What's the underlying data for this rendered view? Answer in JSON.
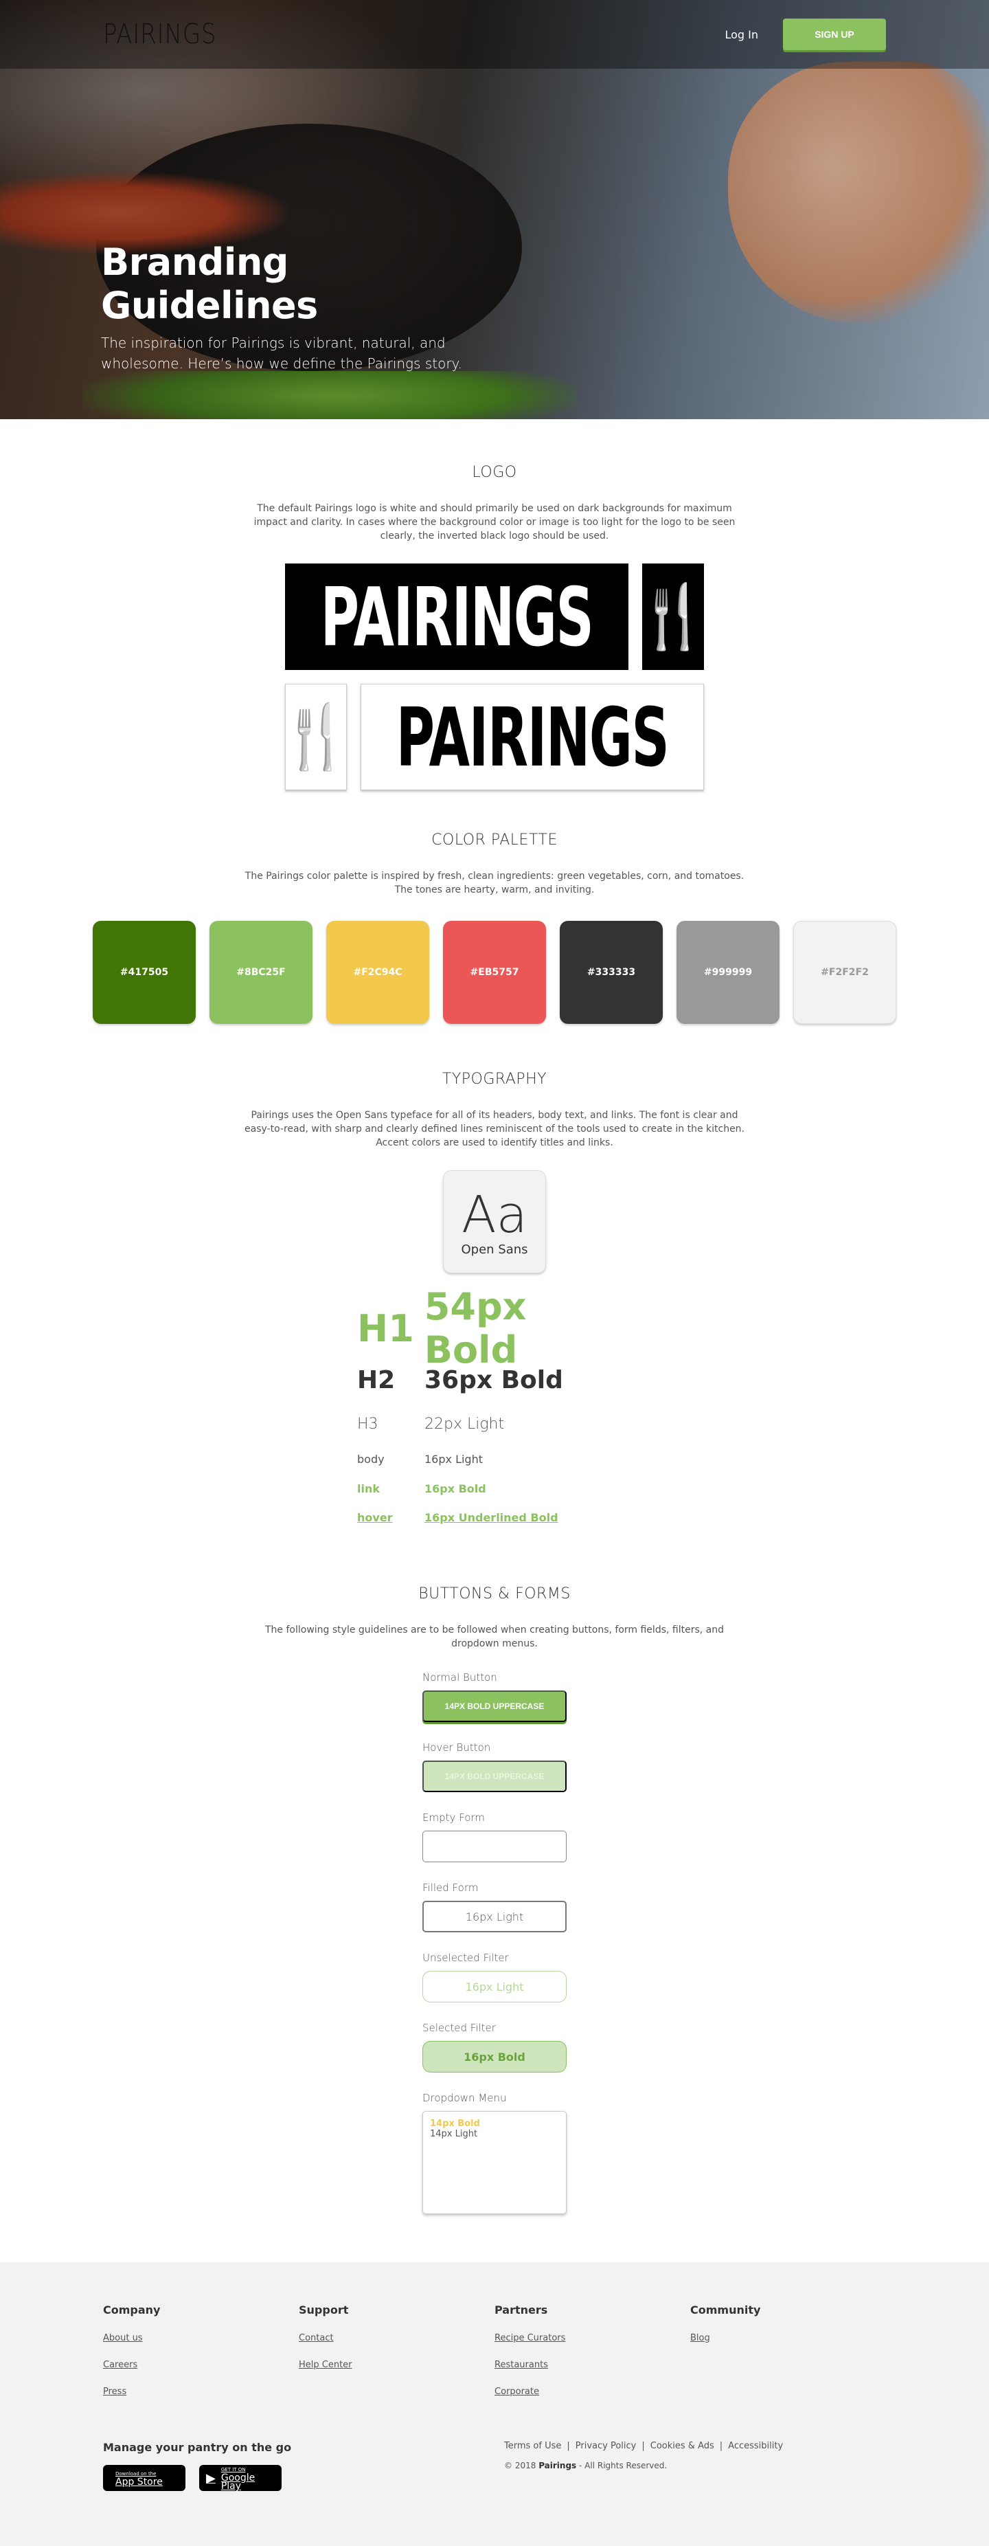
{
  "header": {
    "brand": "PAIRINGS",
    "login": "Log In",
    "signup": "SIGN UP"
  },
  "hero": {
    "title": "Branding Guidelines",
    "subtitle": "The inspiration for Pairings is vibrant, natural, and wholesome. Here’s how we define the Pairings story."
  },
  "logo": {
    "title": "LOGO",
    "description": "The default Pairings logo is white and should primarily be used on dark backgrounds for maximum impact and clarity. In cases where the background color or image is too light for the logo to be seen clearly, the inverted black logo should be used.",
    "wordmark": "PAIRINGS",
    "icon": "🍴"
  },
  "palette": {
    "title": "COLOR PALETTE",
    "description": "The Pairings color palette is inspired by fresh, clean ingredients: green vegetables, corn, and tomatoes. The tones are hearty, warm, and inviting.",
    "swatches": [
      "#417505",
      "#8BC25F",
      "#F2C94C",
      "#EB5757",
      "#333333",
      "#999999",
      "#F2F2F2"
    ],
    "swatch_colors": [
      "#417505",
      "#8bc25f",
      "#f2c94c",
      "#eb5757",
      "#333333",
      "#999999",
      "#f2f2f2"
    ]
  },
  "typography": {
    "title": "TYPOGRAPHY",
    "description": "Pairings uses the Open Sans typeface for all of its headers, body text, and links. The font is clear and easy-to-read, with sharp and clearly defined lines reminiscent of the tools used to create in the kitchen. Accent colors are used to identify titles and links.",
    "sample": "Aa",
    "font_name": "Open Sans",
    "rows": [
      {
        "name": "H1",
        "spec": "54px Bold"
      },
      {
        "name": "H2",
        "spec": "36px Bold"
      },
      {
        "name": "H3",
        "spec": "22px Light"
      },
      {
        "name": "body",
        "spec": "16px Light"
      },
      {
        "name": "link",
        "spec": "16px Bold"
      },
      {
        "name": "hover",
        "spec": "16px Underlined Bold"
      }
    ]
  },
  "buttons": {
    "title": "BUTTONS & FORMS",
    "description": "The following style guidelines are to be followed  when creating buttons, form fields, filters, and dropdown menus.",
    "normal_label": "Normal Button",
    "normal_text": "14PX BOLD UPPERCASE",
    "hover_label": "Hover Button",
    "hover_text": "14PX BOLD UPPERCASE",
    "empty_label": "Empty Form",
    "filled_label": "Filled Form",
    "filled_text": "16px Light",
    "unselected_label": "Unselected Filter",
    "unselected_text": "16px Light",
    "selected_label": "Selected Filter",
    "selected_text": "16px Bold",
    "dropdown_label": "Dropdown Menu",
    "dropdown_items": [
      "14px Bold",
      "14px Light"
    ]
  },
  "footer": {
    "columns": [
      {
        "head": "Company",
        "links": [
          "About us",
          "Careers",
          "Press"
        ]
      },
      {
        "head": "Support",
        "links": [
          "Contact",
          "Help Center"
        ]
      },
      {
        "head": "Partners",
        "links": [
          "Recipe Curators",
          "Restaurants",
          "Corporate"
        ]
      },
      {
        "head": "Community",
        "links": [
          "Blog"
        ]
      }
    ],
    "pantry": "Manage your pantry on the go",
    "appstore_small": "Download on the",
    "appstore_big": "App Store",
    "googleplay_small": "GET IT ON",
    "googleplay_big": "Google Play",
    "legal": [
      "Terms of Use",
      "|",
      "Privacy Policy",
      "|",
      "Cookies & Ads",
      "|",
      "Accessibility"
    ],
    "copyright_prefix": "© 2018",
    "copyright_brand": "Pairings",
    "copyright_suffix": "- All Rights Reserved."
  }
}
